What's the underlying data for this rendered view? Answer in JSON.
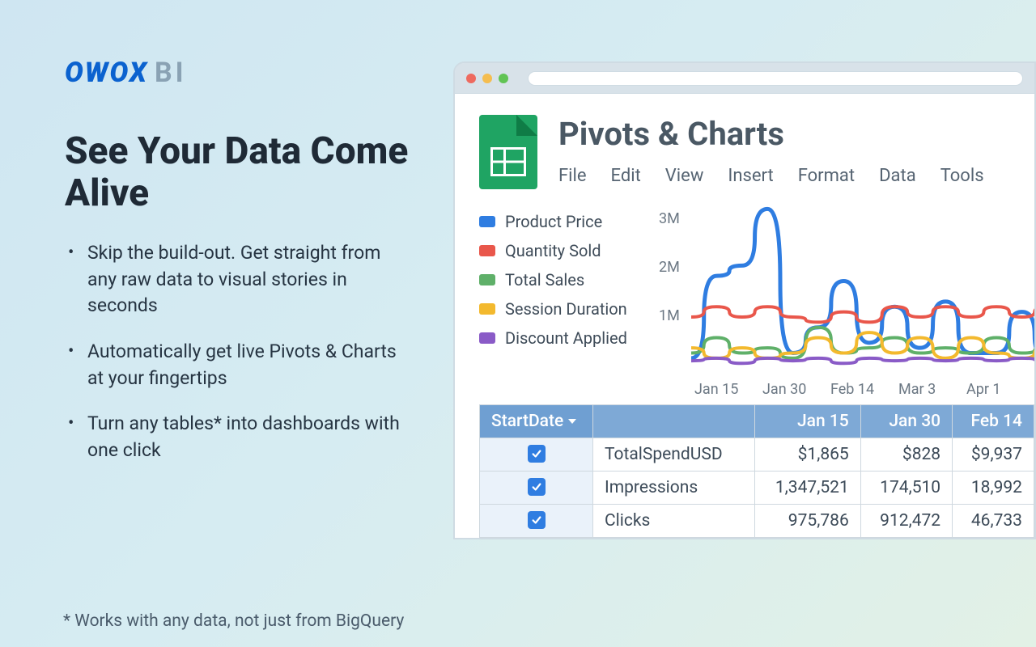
{
  "brand": {
    "name": "OWOX",
    "suffix": "BI"
  },
  "headline": "See Your Data Come Alive",
  "bullets": [
    "Skip the build-out. Get straight from any raw data to visual stories in seconds",
    "Automatically get live Pivots & Charts at your fingertips",
    "Turn any tables* into dashboards with one click"
  ],
  "footnote": "* Works with any data, not just from BigQuery",
  "window": {
    "doc_title": "Pivots & Charts",
    "menus": [
      "File",
      "Edit",
      "View",
      "Insert",
      "Format",
      "Data",
      "Tools"
    ],
    "legend": [
      {
        "label": "Product Price",
        "color": "#2f7de1"
      },
      {
        "label": "Quantity Sold",
        "color": "#e9574b"
      },
      {
        "label": "Total Sales",
        "color": "#5fb069"
      },
      {
        "label": "Session Duration",
        "color": "#f3b92e"
      },
      {
        "label": "Discount Applied",
        "color": "#8a5bc7"
      }
    ],
    "pivot": {
      "start_date_label": "StartDate",
      "columns": [
        "Jan 15",
        "Jan 30",
        "Feb 14"
      ],
      "rows": [
        {
          "metric": "TotalSpendUSD",
          "values": [
            "$1,865",
            "$828",
            "$9,937"
          ]
        },
        {
          "metric": "Impressions",
          "values": [
            "1,347,521",
            "174,510",
            "18,992"
          ]
        },
        {
          "metric": "Clicks",
          "values": [
            "975,786",
            "912,472",
            "46,733"
          ]
        }
      ]
    }
  },
  "chart_data": {
    "type": "line",
    "x": [
      "Jan 15",
      "Jan 30",
      "Feb 14",
      "Mar 3",
      "Apr 1"
    ],
    "yticks": [
      "3M",
      "2M",
      "1M"
    ],
    "ylim": [
      0,
      3.3
    ],
    "series": [
      {
        "name": "Product Price",
        "color": "#2f7de1",
        "values": [
          0.3,
          1.9,
          2.1,
          3.2,
          0.4,
          0.9,
          1.8,
          0.6,
          1.3,
          0.5,
          1.4,
          0.4,
          0.4,
          1.2,
          0.3
        ]
      },
      {
        "name": "Quantity Sold",
        "color": "#e9574b",
        "values": [
          1.1,
          1.3,
          1.1,
          1.3,
          1.1,
          1.0,
          1.2,
          1.0,
          1.3,
          1.1,
          1.3,
          1.1,
          1.3,
          1.1,
          1.3
        ]
      },
      {
        "name": "Total Sales",
        "color": "#5fb069",
        "values": [
          0.4,
          0.7,
          0.4,
          0.5,
          0.3,
          0.9,
          0.4,
          0.5,
          0.7,
          0.4,
          0.5,
          0.4,
          0.7,
          0.4,
          0.5
        ]
      },
      {
        "name": "Session Duration",
        "color": "#f3b92e",
        "values": [
          0.5,
          0.3,
          0.5,
          0.3,
          0.4,
          0.7,
          0.4,
          0.8,
          0.4,
          0.7,
          0.3,
          0.7,
          0.4,
          0.3,
          0.5
        ]
      },
      {
        "name": "Discount Applied",
        "color": "#8a5bc7",
        "values": [
          0.25,
          0.3,
          0.2,
          0.3,
          0.25,
          0.3,
          0.2,
          0.3,
          0.25,
          0.3,
          0.25,
          0.3,
          0.25,
          0.3,
          0.25
        ]
      }
    ]
  }
}
